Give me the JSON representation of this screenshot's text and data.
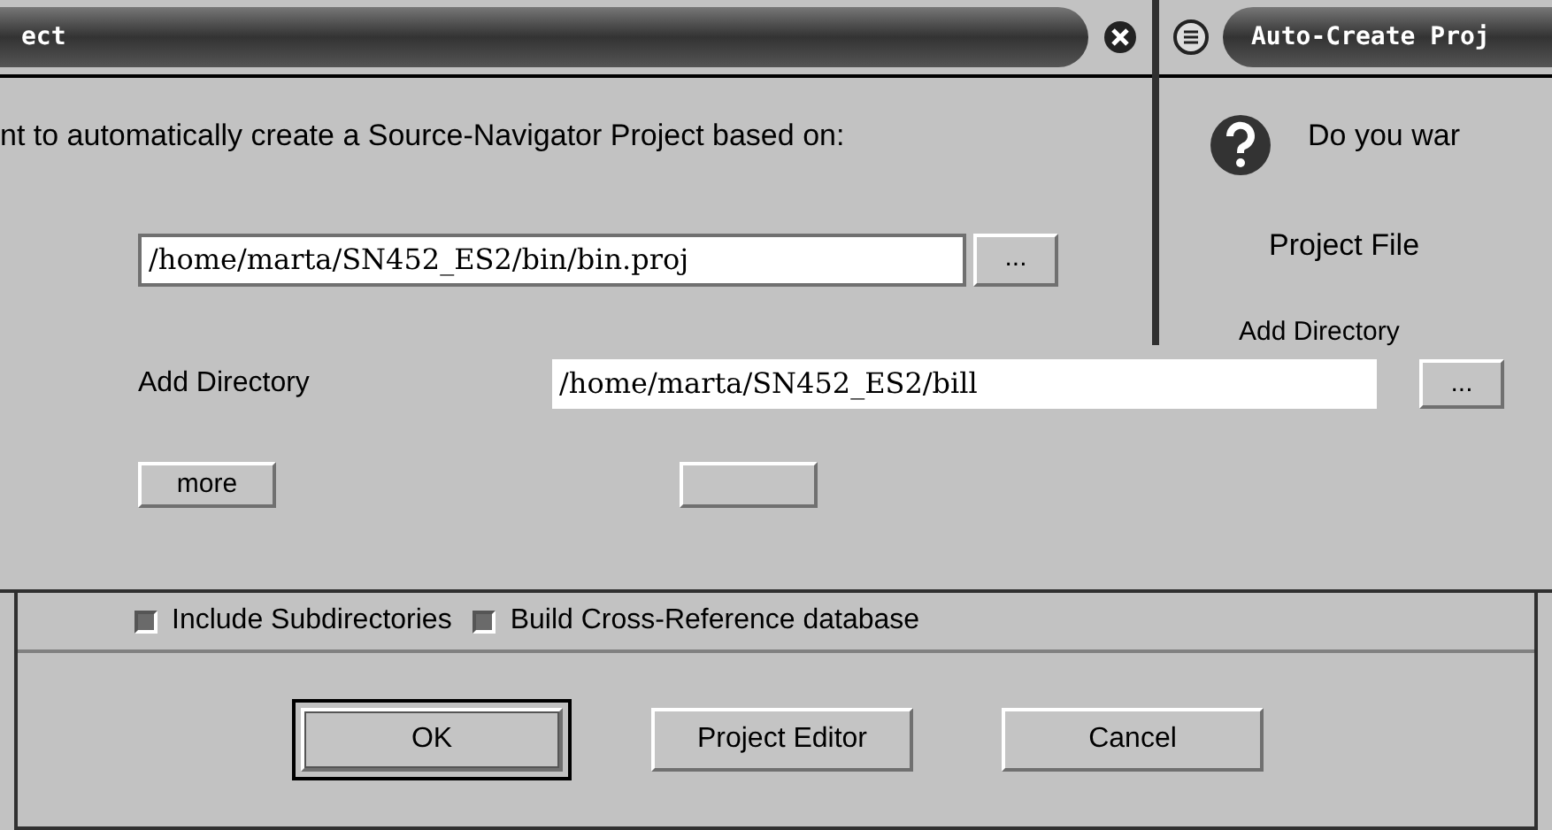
{
  "left_window": {
    "title": "ect",
    "message": "nt to automatically create a Source-Navigator Project based on:",
    "project_file": {
      "value": "/home/marta/SN452_ES2/bin/bin.proj",
      "browse": "..."
    }
  },
  "right_window": {
    "title": "Auto-Create Proj",
    "message": "Do you war",
    "project_file_label": "Project File",
    "add_directory_label": "Add Directory"
  },
  "directory": {
    "label": "Add Directory",
    "value": "/home/marta/SN452_ES2/bill",
    "browse": "...",
    "more": "more"
  },
  "options": [
    {
      "label": "Include Subdirectories",
      "checked": true
    },
    {
      "label": "Build Cross-Reference database",
      "checked": true
    }
  ],
  "buttons": [
    {
      "label": "OK",
      "default": true
    },
    {
      "label": "Project Editor",
      "default": false
    },
    {
      "label": "Cancel",
      "default": false
    }
  ]
}
